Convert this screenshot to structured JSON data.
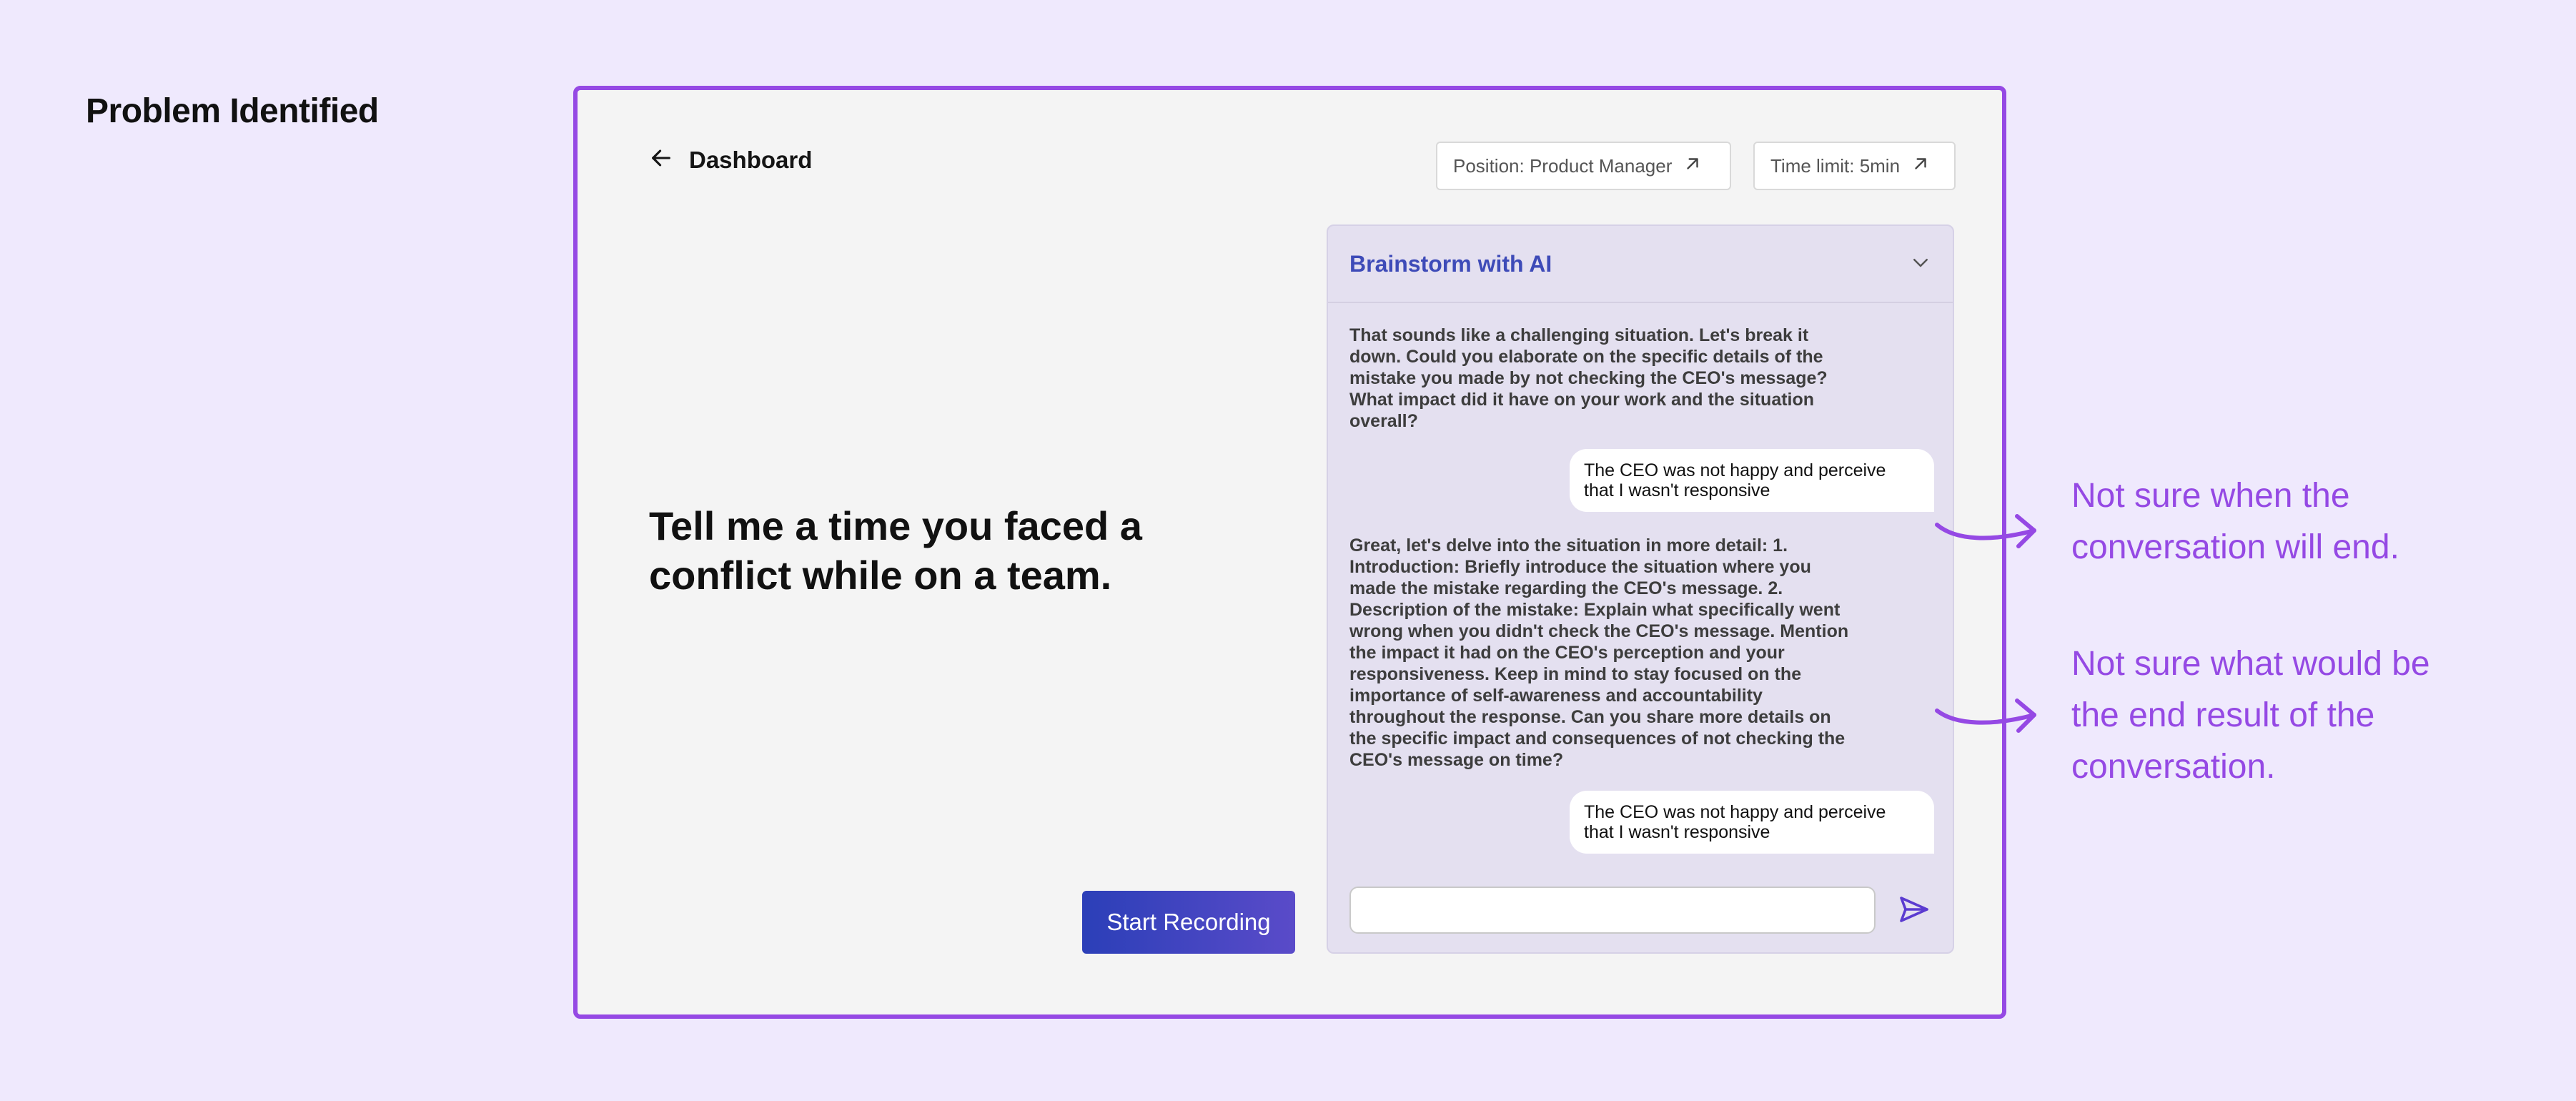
{
  "page": {
    "heading": "Problem Identified"
  },
  "header": {
    "back_label": "Dashboard",
    "position_chip": "Position: Product Manager",
    "time_chip": "Time limit: 5min"
  },
  "main": {
    "question": "Tell me a time you faced a conflict while on a team.",
    "record_button": "Start Recording"
  },
  "chat": {
    "title": "Brainstorm with AI",
    "messages": [
      {
        "role": "ai",
        "text": "That sounds like a challenging situation. Let's break it down. Could you elaborate on the specific details of the mistake you made by not checking the CEO's message? What impact did it have on your work and the situation overall?"
      },
      {
        "role": "user",
        "text": "The CEO was not happy and perceive that I wasn't responsive"
      },
      {
        "role": "ai",
        "text": "Great, let's delve into the situation in more detail: 1. Introduction: Briefly introduce the situation where you made the mistake regarding the CEO's message. 2. Description of the mistake: Explain what specifically went wrong when you didn't check the CEO's message. Mention the impact it had on the CEO's perception and your responsiveness. Keep in mind to stay focused on the importance of self-awareness and accountability throughout the response. Can you share more details on the specific impact and consequences of not checking the CEO's message on time?"
      },
      {
        "role": "user",
        "text": "The CEO was not happy and perceive that I wasn't responsive"
      }
    ],
    "input_value": "",
    "input_placeholder": ""
  },
  "annotations": [
    "Not sure when the conversation will end.",
    "Not sure what would be the end result of the conversation."
  ],
  "colors": {
    "background": "#efe9fd",
    "frame_border": "#9549e4",
    "annotation": "#9549e4",
    "chat_title": "#3e4bb8",
    "button_start": "#2b3fb8",
    "button_end": "#5a4bc9"
  },
  "icons": {
    "back": "arrow-left-icon",
    "chip": "arrow-up-right-icon",
    "collapse": "chevron-down-icon",
    "send": "send-icon"
  }
}
